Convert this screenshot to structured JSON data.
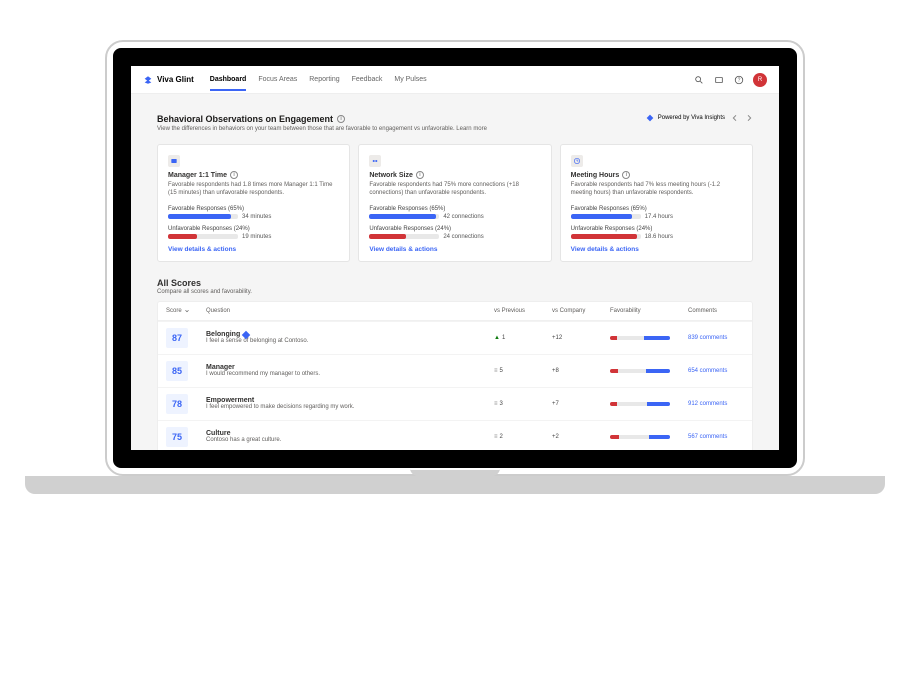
{
  "brand": {
    "name": "Viva Glint"
  },
  "nav": {
    "items": [
      {
        "label": "Dashboard",
        "active": true
      },
      {
        "label": "Focus Areas"
      },
      {
        "label": "Reporting"
      },
      {
        "label": "Feedback"
      },
      {
        "label": "My Pulses"
      }
    ]
  },
  "avatar": {
    "initial": "R"
  },
  "behavioral": {
    "title": "Behavioral Observations on Engagement",
    "subtitle": "View the differences in behaviors on your team between those that are favorable to engagement vs unfavorable. Learn more",
    "powered": "Powered by Viva Insights",
    "cards": [
      {
        "title": "Manager 1:1 Time",
        "desc": "Favorable respondents had 1.8 times more Manager 1:1 Time (15 minutes) than unfavorable respondents.",
        "fav_label": "Favorable Responses (65%)",
        "fav_pct": 90,
        "fav_val": "34 minutes",
        "unfav_label": "Unfavorable Responses (24%)",
        "unfav_pct": 42,
        "unfav_val": "19 minutes",
        "link": "View details & actions"
      },
      {
        "title": "Network Size",
        "desc": "Favorable respondents had 75% more connections (+18 connections) than unfavorable respondents.",
        "fav_label": "Favorable Responses (65%)",
        "fav_pct": 95,
        "fav_val": "42 connections",
        "unfav_label": "Unfavorable Responses (24%)",
        "unfav_pct": 52,
        "unfav_val": "24 connections",
        "link": "View details & actions"
      },
      {
        "title": "Meeting Hours",
        "desc": "Favorable respondents had 7% less meeting hours (-1.2 meeting hours) than unfavorable respondents.",
        "fav_label": "Favorable Responses (65%)",
        "fav_pct": 88,
        "fav_val": "17.4 hours",
        "unfav_label": "Unfavorable Responses (24%)",
        "unfav_pct": 95,
        "unfav_val": "18.6 hours",
        "link": "View details & actions"
      }
    ]
  },
  "allscores": {
    "title": "All Scores",
    "subtitle": "Compare all scores and favorability.",
    "columns": {
      "score": "Score",
      "question": "Question",
      "vs_prev": "vs Previous",
      "vs_comp": "vs Company",
      "fav": "Favorability",
      "comments": "Comments"
    },
    "rows": [
      {
        "score": "87",
        "title": "Belonging",
        "flag": true,
        "sub": "I feel a sense of belonging at Contoso.",
        "vs_prev_dir": "up",
        "vs_prev": "1",
        "vs_comp": "+12",
        "unfav": 12,
        "mid": 45,
        "fav": 43,
        "comments": "839 comments"
      },
      {
        "score": "85",
        "title": "Manager",
        "flag": false,
        "sub": "I would recommend my manager to others.",
        "vs_prev_dir": "same",
        "vs_prev": "5",
        "vs_comp": "+8",
        "unfav": 14,
        "mid": 46,
        "fav": 40,
        "comments": "654 comments"
      },
      {
        "score": "78",
        "title": "Empowerment",
        "flag": false,
        "sub": "I feel empowered to make decisions regarding my work.",
        "vs_prev_dir": "same",
        "vs_prev": "3",
        "vs_comp": "+7",
        "unfav": 12,
        "mid": 50,
        "fav": 38,
        "comments": "912 comments"
      },
      {
        "score": "75",
        "title": "Culture",
        "flag": false,
        "sub": "Contoso has a great culture.",
        "vs_prev_dir": "same",
        "vs_prev": "2",
        "vs_comp": "+2",
        "unfav": 15,
        "mid": 50,
        "fav": 35,
        "comments": "567 comments"
      }
    ]
  }
}
